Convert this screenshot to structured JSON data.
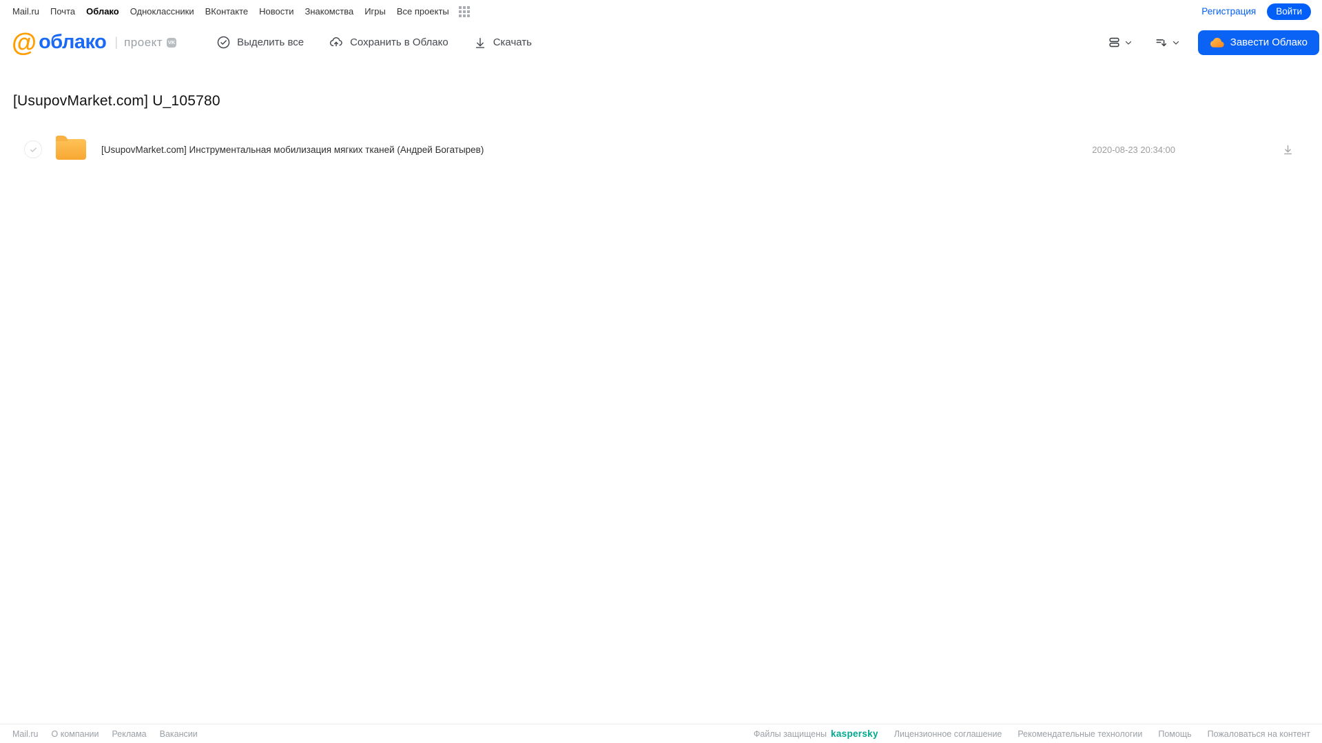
{
  "colors": {
    "accent_blue": "#005ff9",
    "button_blue": "#0b63f6",
    "logo_orange": "#ff9e00",
    "logo_blue": "#1a6af5",
    "folder_orange": "#f9ae3b",
    "kaspersky_teal": "#00a88e",
    "muted_gray": "#9aa0a6"
  },
  "top_nav": {
    "links": [
      "Mail.ru",
      "Почта",
      "Облако",
      "Одноклассники",
      "ВКонтакте",
      "Новости",
      "Знакомства",
      "Игры",
      "Все проекты"
    ],
    "active_link": "Облако",
    "registration": "Регистрация",
    "login": "Войти"
  },
  "header": {
    "logo_at": "@",
    "logo_text": "облако",
    "logo_separator": "|",
    "logo_suffix": "проект",
    "vk_badge": "VK",
    "actions": [
      {
        "label": "Выделить все",
        "icon": "check-circle-icon"
      },
      {
        "label": "Сохранить в Облако",
        "icon": "cloud-upload-icon"
      },
      {
        "label": "Скачать",
        "icon": "download-icon"
      }
    ],
    "get_cloud_button": "Завести Облако"
  },
  "main": {
    "title": "[UsupovMarket.com] U_105780",
    "files": [
      {
        "type": "folder",
        "name": "[UsupovMarket.com] Инструментальная мобилизация мягких тканей (Андрей Богатырев)",
        "date": "2020-08-23 20:34:00"
      }
    ]
  },
  "footer": {
    "left_links": [
      "Mail.ru",
      "О компании",
      "Реклама",
      "Вакансии"
    ],
    "protected_text": "Файлы защищены",
    "kaspersky_logo": "kaspersky",
    "right_links": [
      "Лицензионное соглашение",
      "Рекомендательные технологии",
      "Помощь",
      "Пожаловаться на контент"
    ]
  }
}
